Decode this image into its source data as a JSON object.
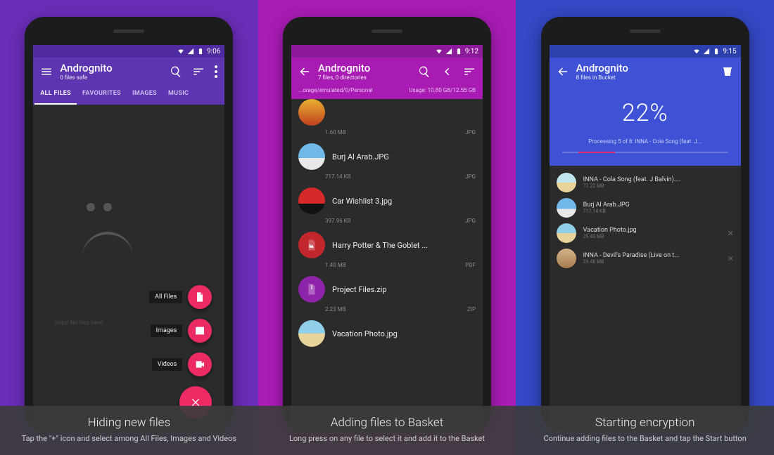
{
  "panels": [
    {
      "bg": "panel-0",
      "status_time": "9:06",
      "appbar": {
        "title": "Andrognito",
        "subtitle": "0 files safe",
        "nav": "menu"
      },
      "tabs": [
        "ALL FILES",
        "FAVOURITES",
        "IMAGES",
        "MUSIC"
      ],
      "active_tab": 0,
      "empty_message": "Oops! No files here!",
      "fab_labels": [
        "All Files",
        "Images",
        "Videos"
      ],
      "caption_title": "Hiding new files",
      "caption_sub": "Tap the \"+\" icon and select among All Files, Images and Videos"
    },
    {
      "bg": "panel-1",
      "status_time": "9:12",
      "appbar": {
        "title": "Andrognito",
        "subtitle": "7 files, 0 directories",
        "nav": "back"
      },
      "path_left": "...orage/emulated/0/Personal",
      "path_right": "Usage: 10.80 GB/12.55 GB",
      "files": [
        {
          "size": "1.60 MB",
          "ext": "JPG",
          "name": "Burj Al Arab.JPG",
          "thumb": "tc-sky",
          "lead": true
        },
        {
          "size": "717.14 KB",
          "ext": "JPG",
          "name": "Car Wishlist 3.jpg",
          "thumb": "tc-car"
        },
        {
          "size": "397.96 KB",
          "ext": "JPG",
          "name": "Harry Potter & The Goblet ...",
          "thumb": "tc-pdf",
          "icon": "pdf"
        },
        {
          "size": "1.40 MB",
          "ext": "PDF",
          "name": "Project Files.zip",
          "thumb": "tc-zip",
          "icon": "zip"
        },
        {
          "size": "2.23 MB",
          "ext": "ZIP",
          "name": "Vacation Photo.jpg",
          "thumb": "tc-beach",
          "tail": true
        }
      ],
      "caption_title": "Adding files to Basket",
      "caption_sub": "Long press on any file to select it and add it to the Basket"
    },
    {
      "bg": "panel-2",
      "status_time": "9:15",
      "appbar": {
        "title": "Andrognito",
        "subtitle": "8 files in Bucket",
        "nav": "back"
      },
      "progress": {
        "pct": "22%",
        "msg": "Processing 5 of 8: INNA - Cola Song (feat. J..."
      },
      "bucket": [
        {
          "name": "INNA - Cola Song (feat. J Balvin)....",
          "size": "77.22 MB",
          "thumb": "tc-inna"
        },
        {
          "name": "Burj Al Arab.JPG",
          "size": "717.14 KB",
          "thumb": "tc-sky"
        },
        {
          "name": "Vacation Photo.jpg",
          "size": "29.43 MB",
          "thumb": "tc-beach",
          "dismiss": true
        },
        {
          "name": "INNA - Devil's Paradise (Live on t...",
          "size": "29.48 MB",
          "thumb": "tc-pers",
          "dismiss": true
        }
      ],
      "caption_title": "Starting encryption",
      "caption_sub": "Continue adding files to the Basket and tap the Start button"
    }
  ]
}
